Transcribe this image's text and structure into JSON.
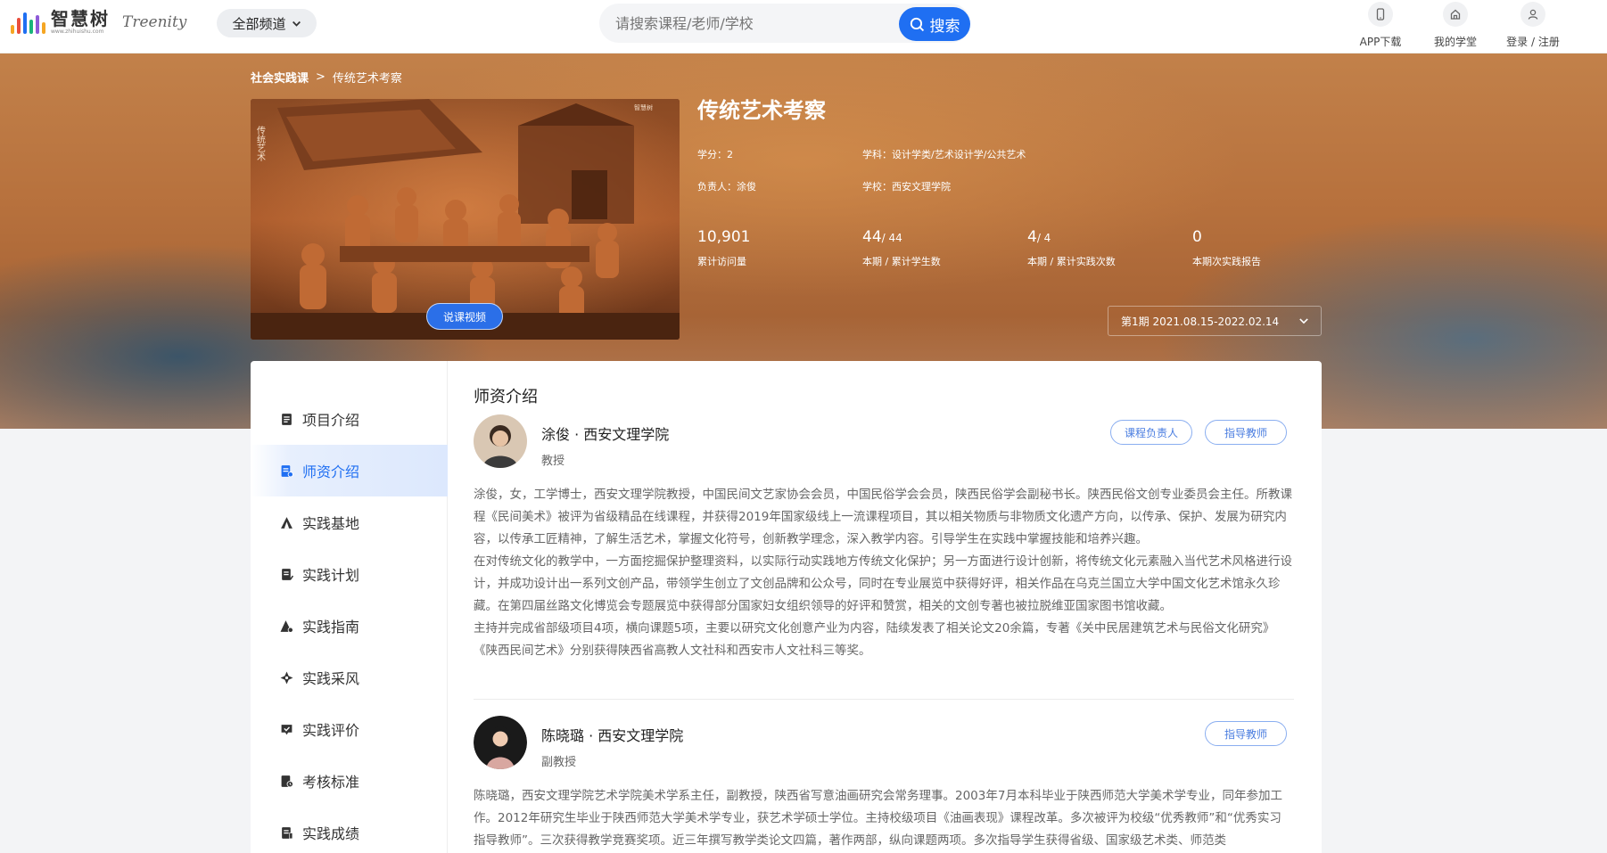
{
  "header": {
    "logo_cn": "智慧树",
    "logo_url": "www.zhihuishu.com",
    "logo_en": "Treenity",
    "channel_label": "全部频道",
    "search_placeholder": "请搜索课程/老师/学校",
    "search_button": "搜索",
    "nav": [
      {
        "label": "APP下载",
        "icon": "phone-icon"
      },
      {
        "label": "我的学堂",
        "icon": "home-icon"
      },
      {
        "label": "登录 / 注册",
        "icon": "user-icon"
      }
    ]
  },
  "breadcrumb": {
    "parent": "社会实践课",
    "separator": ">",
    "current": "传统艺术考察"
  },
  "course": {
    "title": "传统艺术考察",
    "video_button": "说课视频",
    "credit": "学分：2",
    "subject": "学科：设计学类/艺术设计学/公共艺术",
    "leader": "负责人：涂俊",
    "school": "学校：西安文理学院",
    "stats": [
      {
        "value": "10,901",
        "sub": "",
        "label": "累计访问量"
      },
      {
        "value": "44",
        "sub": "/ 44",
        "label": "本期 / 累计学生数"
      },
      {
        "value": "4",
        "sub": "/ 4",
        "label": "本期 / 累计实践次数"
      },
      {
        "value": "0",
        "sub": "",
        "label": "本期次实践报告"
      }
    ],
    "period": "第1期 2021.08.15-2022.02.14"
  },
  "sidebar": {
    "items": [
      {
        "label": "项目介绍",
        "icon": "document-icon",
        "active": false
      },
      {
        "label": "师资介绍",
        "icon": "teacher-icon",
        "active": true
      },
      {
        "label": "实践基地",
        "icon": "base-icon",
        "active": false
      },
      {
        "label": "实践计划",
        "icon": "plan-icon",
        "active": false
      },
      {
        "label": "实践指南",
        "icon": "guide-icon",
        "active": false
      },
      {
        "label": "实践采风",
        "icon": "collect-icon",
        "active": false
      },
      {
        "label": "实践评价",
        "icon": "comment-icon",
        "active": false
      },
      {
        "label": "考核标准",
        "icon": "standard-icon",
        "active": false
      },
      {
        "label": "实践成绩",
        "icon": "grade-icon",
        "active": false
      }
    ]
  },
  "main": {
    "section_title": "师资介绍",
    "teachers": [
      {
        "name": "涂俊 · 西安文理学院",
        "title": "教授",
        "tags": [
          "课程负责人",
          "指导教师"
        ],
        "bio": "涂俊，女，工学博士，西安文理学院教授，中国民间文艺家协会会员，中国民俗学会会员，陕西民俗学会副秘书长。陕西民俗文创专业委员会主任。所教课程《民间美术》被评为省级精品在线课程，并获得2019年国家级线上一流课程项目，其以相关物质与非物质文化遗产方向，以传承、保护、发展为研究内容，以传承工匠精神，了解生活艺术，掌握文化符号，创新教学理念，深入教学内容。引导学生在实践中掌握技能和培养兴趣。\n在对传统文化的教学中，一方面挖掘保护整理资料，以实际行动实践地方传统文化保护；另一方面进行设计创新，将传统文化元素融入当代艺术风格进行设计，并成功设计出一系列文创产品，带领学生创立了文创品牌和公众号，同时在专业展览中获得好评，相关作品在乌克兰国立大学中国文化艺术馆永久珍藏。在第四届丝路文化博览会专题展览中获得部分国家妇女组织领导的好评和赞赏，相关的文创专著也被拉脱维亚国家图书馆收藏。\n主持并完成省部级项目4项，横向课题5项，主要以研究文化创意产业为内容，陆续发表了相关论文20余篇，专著《关中民居建筑艺术与民俗文化研究》《陕西民间艺术》分别获得陕西省高教人文社科和西安市人文社科三等奖。"
      },
      {
        "name": "陈晓璐 · 西安文理学院",
        "title": "副教授",
        "tags": [
          "指导教师"
        ],
        "bio": "陈晓璐，西安文理学院艺术学院美术学系主任，副教授，陕西省写意油画研究会常务理事。2003年7月本科毕业于陕西师范大学美术学专业，同年参加工作。2012年研究生毕业于陕西师范大学美术学专业，获艺术学硕士学位。主持校级项目《油画表现》课程改革。多次被评为校级“优秀教师”和“优秀实习指导教师”。三次获得教学竞赛奖项。近三年撰写教学类论文四篇，著作两部，纵向课题两项。多次指导学生获得省级、国家级艺术类、师范类"
      }
    ]
  },
  "colors": {
    "accent": "#1f6ff2",
    "tag_border": "#8aaef0",
    "active_bg": "#dce8fd"
  }
}
